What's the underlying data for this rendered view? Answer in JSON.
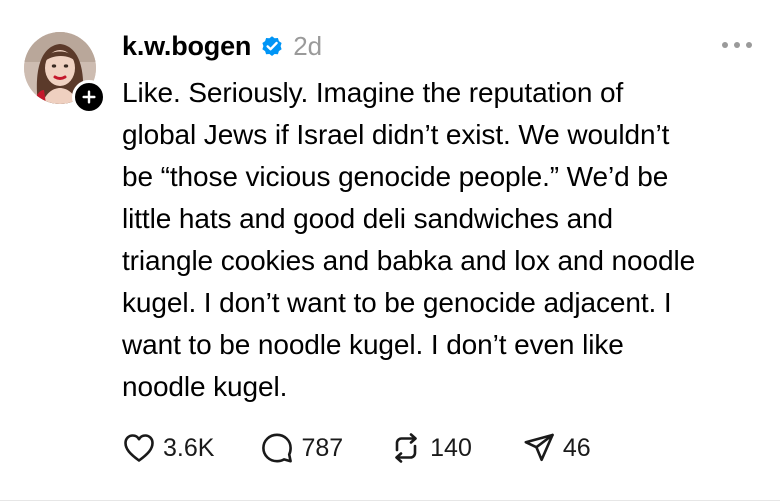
{
  "post": {
    "username": "k.w.bogen",
    "timestamp": "2d",
    "verified": true,
    "body_lines": [
      "Like. Seriously. Imagine the reputation of",
      "global Jews if Israel didn’t exist. We wouldn’t",
      "be “those vicious genocide people.” We’d be",
      "little hats and good deli sandwiches and",
      "triangle cookies and babka and lox and noodle",
      "kugel. I don’t want to be genocide adjacent. I",
      "want to be noodle kugel. I don’t even like",
      "noodle kugel."
    ],
    "actions": {
      "likes": "3.6K",
      "replies": "787",
      "reposts": "140",
      "shares": "46"
    },
    "icons": {
      "verified": "verified-badge-icon",
      "follow": "plus-icon",
      "more": "more-options-icon",
      "like": "heart-icon",
      "reply": "comment-icon",
      "repost": "repost-icon",
      "share": "send-icon"
    },
    "colors": {
      "verified_blue": "#0095f6",
      "muted": "#9a9a9a",
      "text": "#000000"
    }
  }
}
